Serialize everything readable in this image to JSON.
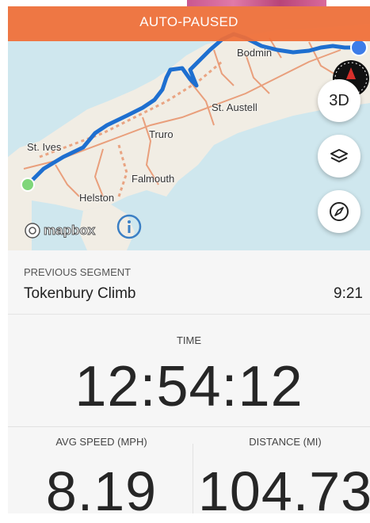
{
  "banner": {
    "text": "AUTO-PAUSED",
    "color": "#f06e37"
  },
  "map": {
    "towns": [
      "Bodmin",
      "St. Austell",
      "Truro",
      "St. Ives",
      "Falmouth",
      "Helston"
    ],
    "attribution": "mapbox",
    "route_color": "#1e6fd0",
    "start_marker_color": "#7fd67a",
    "current_marker_color": "#3d7ce8",
    "controls": {
      "three_d_label": "3D",
      "layers_icon": "layers-icon",
      "compass_icon": "compass-icon",
      "info_icon": "info-icon"
    }
  },
  "segment": {
    "label": "PREVIOUS SEGMENT",
    "name": "Tokenbury Climb",
    "time": "9:21"
  },
  "stats": {
    "time_label": "TIME",
    "time_value": "12:54:12",
    "avg_speed_label": "AVG SPEED (MPH)",
    "avg_speed_value": "8.19",
    "distance_label": "DISTANCE (MI)",
    "distance_value": "104.73"
  }
}
